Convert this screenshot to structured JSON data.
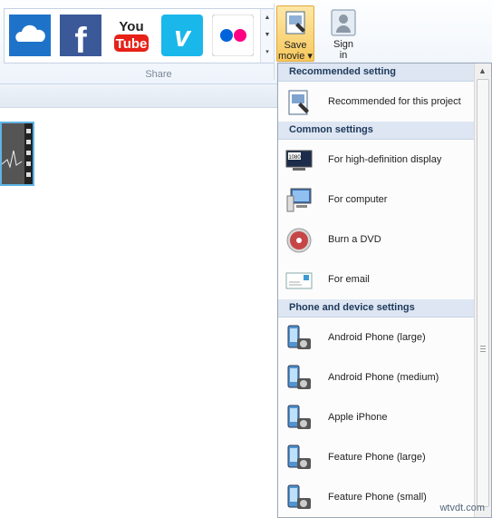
{
  "ribbon": {
    "group_label": "Share",
    "save_label_1": "Save",
    "save_label_2": "movie ▾",
    "sign_label_1": "Sign",
    "sign_label_2": "in"
  },
  "share_services": [
    {
      "name": "onedrive-icon"
    },
    {
      "name": "facebook-icon"
    },
    {
      "name": "youtube-icon"
    },
    {
      "name": "vimeo-icon"
    },
    {
      "name": "flickr-icon"
    }
  ],
  "menu": {
    "sections": [
      {
        "heading": "Recommended setting",
        "items": [
          {
            "label": "Recommended for this project",
            "icon": "recommended-icon"
          }
        ]
      },
      {
        "heading": "Common settings",
        "items": [
          {
            "label": "For high-definition display",
            "icon": "hd-display-icon"
          },
          {
            "label": "For computer",
            "icon": "computer-icon"
          },
          {
            "label": "Burn a DVD",
            "icon": "dvd-icon"
          },
          {
            "label": "For email",
            "icon": "email-icon"
          }
        ]
      },
      {
        "heading": "Phone and device settings",
        "items": [
          {
            "label": "Android Phone (large)",
            "icon": "phone-icon"
          },
          {
            "label": "Android Phone (medium)",
            "icon": "phone-icon"
          },
          {
            "label": "Apple iPhone",
            "icon": "phone-icon"
          },
          {
            "label": "Feature Phone (large)",
            "icon": "phone-icon"
          },
          {
            "label": "Feature Phone (small)",
            "icon": "phone-icon"
          }
        ]
      }
    ]
  },
  "watermark": "wtvdt.com"
}
